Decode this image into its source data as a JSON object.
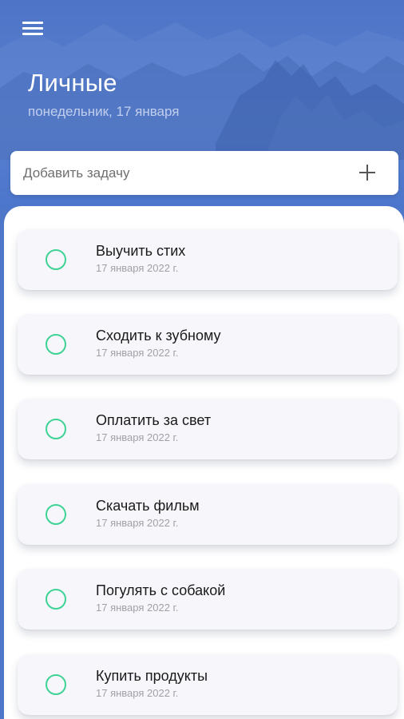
{
  "header": {
    "list_title": "Личные",
    "date": "понедельник, 17 января",
    "menu_icon": "hamburger-menu-icon"
  },
  "add_task": {
    "placeholder": "Добавить задачу",
    "add_icon": "plus-icon"
  },
  "tasks": [
    {
      "title": "Выучить стих",
      "date": "17 января 2022 г."
    },
    {
      "title": "Сходить к зубному",
      "date": "17 января 2022 г."
    },
    {
      "title": "Оплатить за свет",
      "date": "17 января 2022 г."
    },
    {
      "title": "Скачать фильм",
      "date": "17 января 2022 г."
    },
    {
      "title": "Погулять с собакой",
      "date": "17 января 2022 г."
    },
    {
      "title": "Купить продукты",
      "date": "17 января 2022 г."
    }
  ],
  "colors": {
    "header_blue": "#4f77c9",
    "check_green": "#3ed295",
    "card_bg": "#f7f7fb"
  }
}
